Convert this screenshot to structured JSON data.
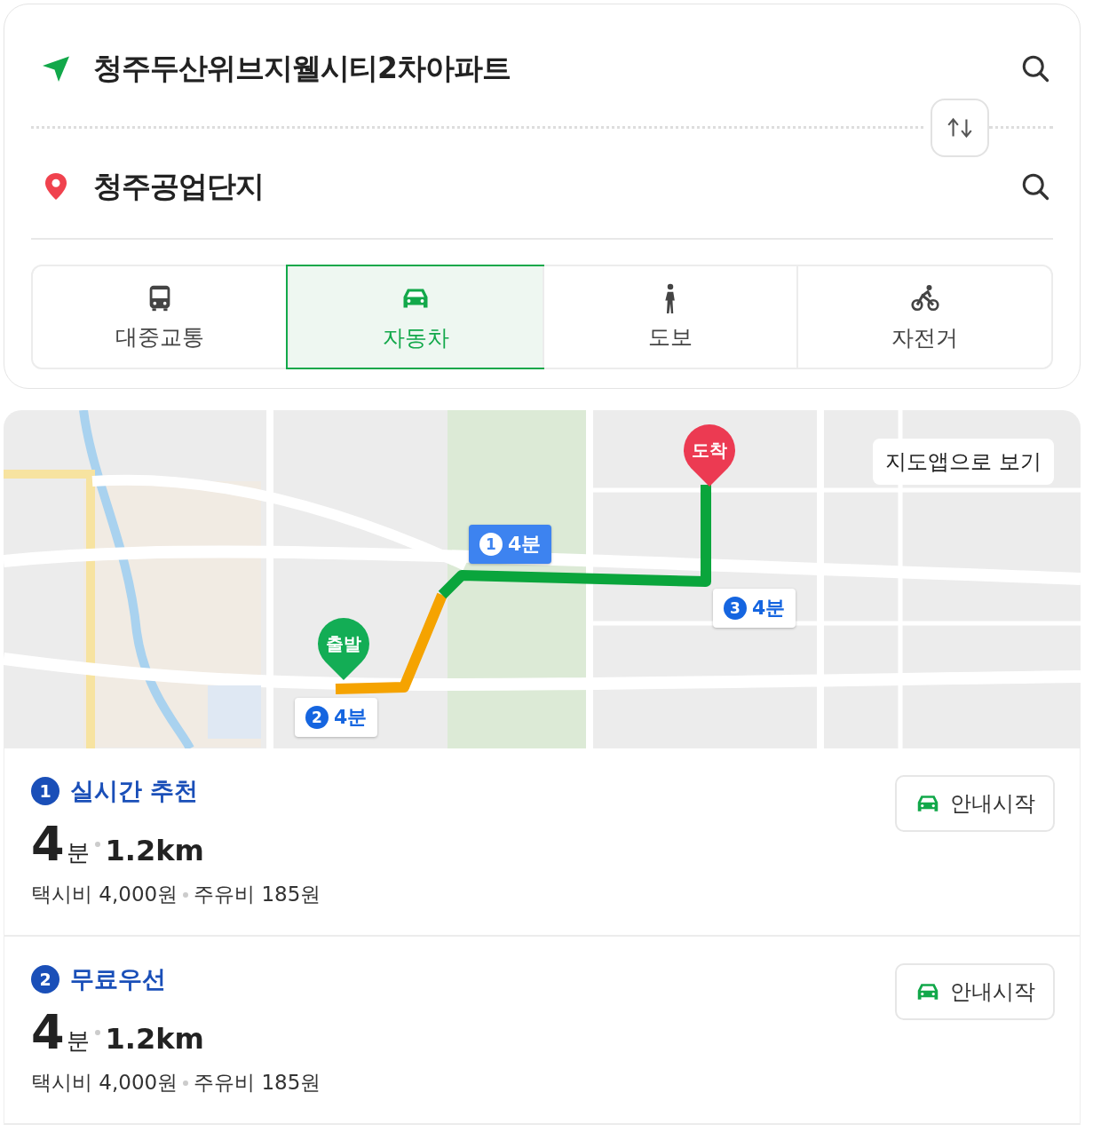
{
  "origin": {
    "name": "청주두산위브지웰시티2차아파트"
  },
  "destination": {
    "name": "청주공업단지"
  },
  "modes": [
    {
      "kind": "bus",
      "label": "대중교통",
      "selected": false
    },
    {
      "kind": "car",
      "label": "자동차",
      "selected": true
    },
    {
      "kind": "walk",
      "label": "도보",
      "selected": false
    },
    {
      "kind": "bike",
      "label": "자전거",
      "selected": false
    }
  ],
  "map": {
    "kind": "picture",
    "open_button": "지도앱으로 보기",
    "start_label": "출발",
    "end_label": "도착",
    "segments": [
      {
        "number": "1",
        "time": "4분",
        "selected": true
      },
      {
        "number": "2",
        "time": "4분",
        "selected": false
      },
      {
        "number": "3",
        "time": "4분",
        "selected": false
      }
    ]
  },
  "routes": [
    {
      "number": "1",
      "name": "실시간 추천",
      "time_value": "4",
      "time_unit": "분",
      "distance": "1.2km",
      "taxi": "택시비 4,000원",
      "fuel": "주유비 185원",
      "button": "안내시작"
    },
    {
      "number": "2",
      "name": "무료우선",
      "time_value": "4",
      "time_unit": "분",
      "distance": "1.2km",
      "taxi": "택시비 4,000원",
      "fuel": "주유비 185원",
      "button": "안내시작"
    }
  ]
}
